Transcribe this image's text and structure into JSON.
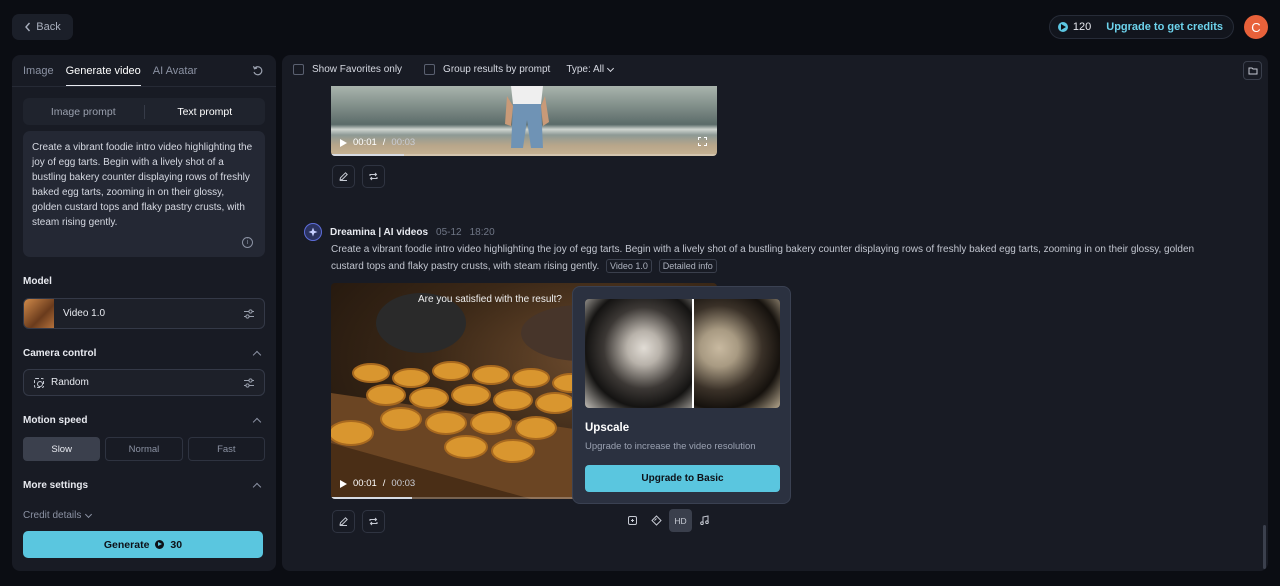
{
  "topbar": {
    "back_label": "Back",
    "credits": "120",
    "upgrade_credits_label": "Upgrade to get credits",
    "avatar_initial": "C"
  },
  "left": {
    "tabs": [
      {
        "label": "Image",
        "active": false
      },
      {
        "label": "Generate video",
        "active": true
      },
      {
        "label": "AI Avatar",
        "active": false
      }
    ],
    "prompt_modes": {
      "image": "Image prompt",
      "text": "Text prompt",
      "active": "text"
    },
    "prompt_text": "Create a vibrant foodie intro video highlighting the joy of egg tarts. Begin with a lively shot of a bustling bakery counter displaying rows of freshly baked egg tarts, zooming in on their glossy, golden custard tops and flaky pastry crusts, with steam rising gently.",
    "model_label": "Model",
    "model_value": "Video 1.0",
    "camera_label": "Camera control",
    "camera_value": "Random",
    "motion_label": "Motion speed",
    "speeds": [
      {
        "label": "Slow",
        "active": true
      },
      {
        "label": "Normal",
        "active": false
      },
      {
        "label": "Fast",
        "active": false
      }
    ],
    "more_settings_label": "More settings",
    "credit_details_label": "Credit details",
    "generate_label": "Generate",
    "generate_cost": "30"
  },
  "main": {
    "filters": {
      "favorites_label": "Show Favorites only",
      "group_label": "Group results by prompt",
      "type_label": "Type: All"
    },
    "video1": {
      "time_current": "00:01",
      "time_total": "00:03",
      "progress": 0.19
    },
    "result": {
      "author": "Dreamina | AI videos",
      "date": "05-12",
      "time": "18:20",
      "prompt": "Create a vibrant foodie intro video highlighting the joy of egg tarts. Begin with a lively shot of a bustling bakery counter displaying rows of freshly baked egg tarts, zooming in on their glossy, golden custard tops and flaky pastry crusts, with steam rising gently.",
      "tag_model": "Video 1.0",
      "tag_detail": "Detailed info"
    },
    "video2": {
      "satisfied_prompt": "Are you satisfied with the result?",
      "time_current": "00:01",
      "time_total": "00:03",
      "progress": 0.21
    },
    "upscale_popup": {
      "title": "Upscale",
      "subtitle": "Upgrade to increase the video resolution",
      "button_label": "Upgrade to Basic"
    },
    "toolbar": {
      "hd_label": "HD"
    }
  },
  "colors": {
    "accent": "#5ac6df",
    "avatar": "#e8613a",
    "background": "#0b0d13",
    "panel": "#181b24"
  }
}
